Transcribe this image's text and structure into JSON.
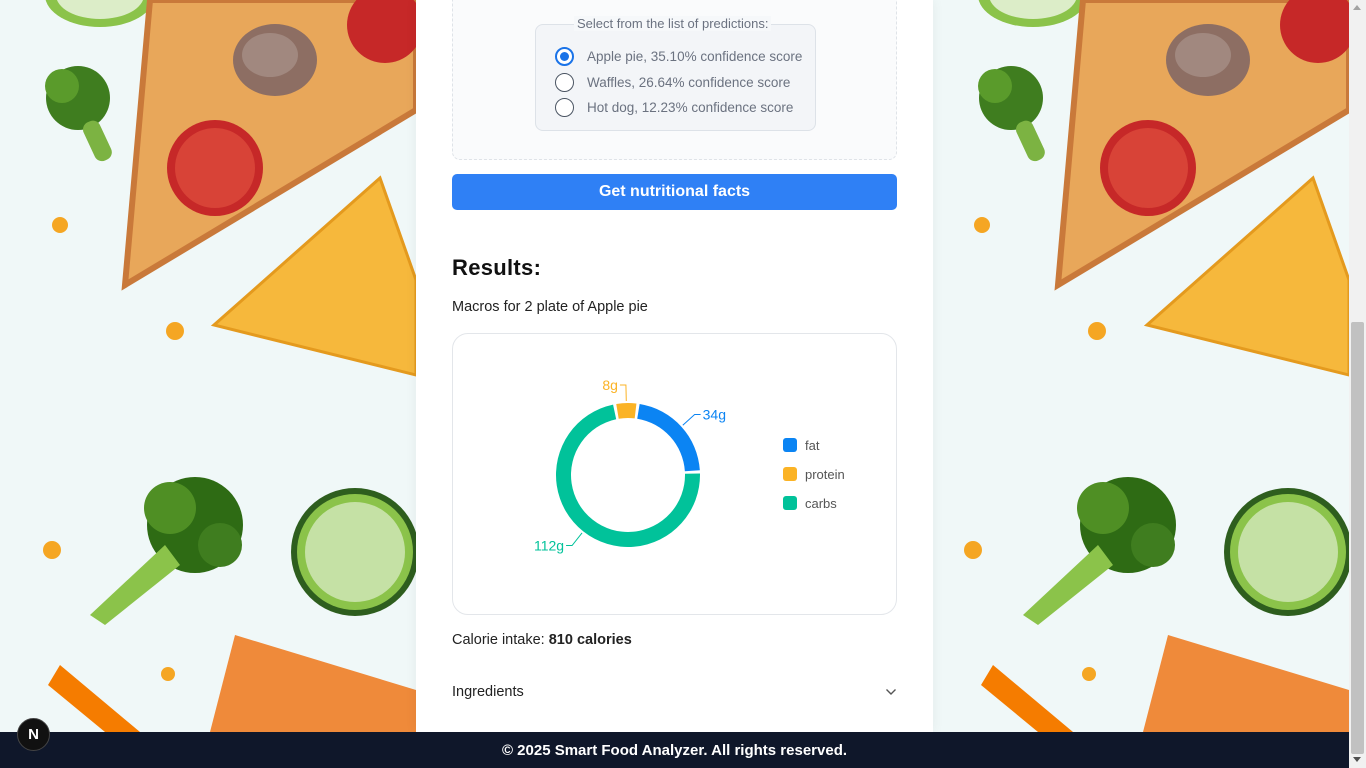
{
  "predictions": {
    "legend": "Select from the list of predictions:",
    "options": [
      {
        "label": "Apple pie, 35.10% confidence score",
        "selected": true
      },
      {
        "label": "Waffles, 26.64% confidence score",
        "selected": false
      },
      {
        "label": "Hot dog, 12.23% confidence score",
        "selected": false
      }
    ]
  },
  "actions": {
    "get_facts_label": "Get nutritional facts"
  },
  "results": {
    "title": "Results:",
    "macros_text": "Macros for 2 plate of Apple pie",
    "calorie_label": "Calorie intake:",
    "calorie_value": "810 calories",
    "ingredients_label": "Ingredients"
  },
  "chart_data": {
    "type": "pie",
    "categories": [
      "fat",
      "protein",
      "carbs"
    ],
    "values": [
      34,
      8,
      112
    ],
    "data_labels": [
      "34g",
      "8g",
      "112g"
    ],
    "colors": [
      "#0b84f3",
      "#fbb325",
      "#01c29a"
    ],
    "donut": true,
    "legend_position": "right"
  },
  "footer": {
    "text": "© 2025 Smart Food Analyzer. All rights reserved."
  },
  "badge": {
    "text": "N"
  }
}
